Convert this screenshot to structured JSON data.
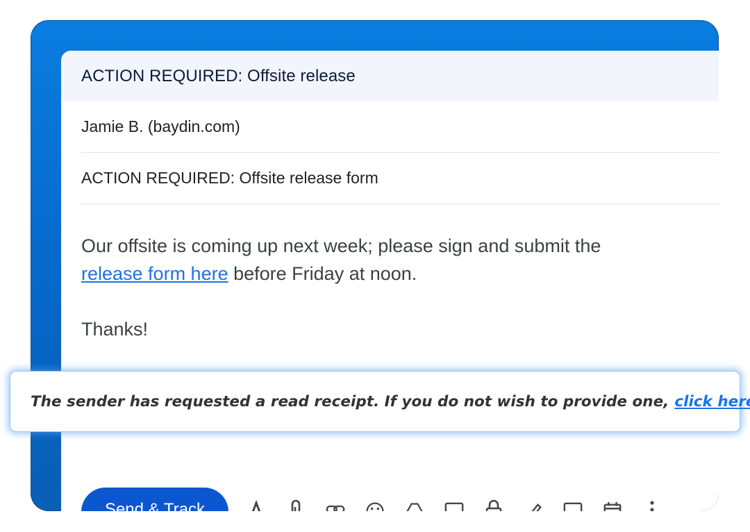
{
  "compose": {
    "header_title": "ACTION REQUIRED: Offsite release",
    "recipient": "Jamie B. (baydin.com)",
    "subject": "ACTION REQUIRED: Offsite release form",
    "body": {
      "line1": "Our offsite is coming up next week; please sign and submit the",
      "link_text": "release form here",
      "line2_rest": "before Friday at noon.",
      "closing": "Thanks!"
    },
    "send_button": "Send & Track"
  },
  "toolbar_icons": [
    "format-text-icon",
    "attach-icon",
    "link-icon",
    "emoji-icon",
    "drive-icon",
    "photo-icon",
    "lock-icon",
    "signature-icon",
    "template-icon",
    "schedule-icon",
    "more-options-icon"
  ],
  "banner": {
    "message": "The sender has requested a read receipt. If you do not wish to provide one,",
    "link_text": "click here."
  },
  "colors": {
    "frame_blue": "#0567c9",
    "send_button": "#0b57d0",
    "link": "#1a73e8",
    "header_bg": "#f2f6fc"
  }
}
